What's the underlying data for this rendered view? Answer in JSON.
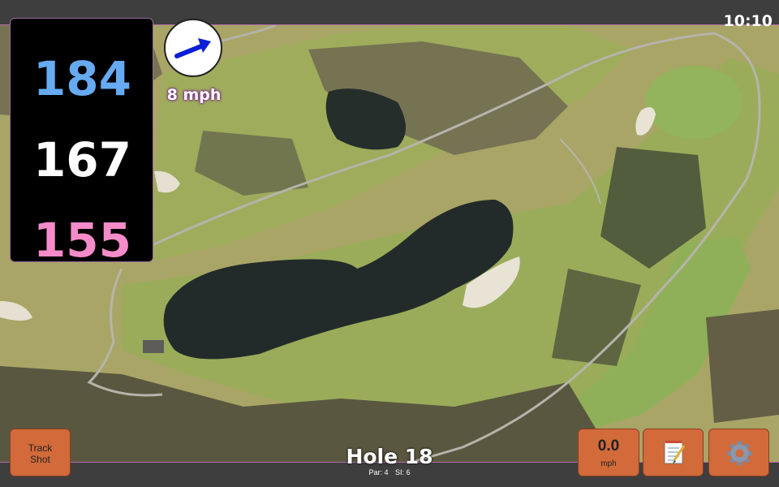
{
  "status": {
    "clock": "10:10"
  },
  "distances": {
    "back": "184",
    "middle": "167",
    "front": "155"
  },
  "wind": {
    "speed": "8 mph",
    "icon": "wind-direction-arrow-icon",
    "arrow_color": "#0a1fd6"
  },
  "hole": {
    "title": "Hole 18",
    "par": "Par: 4",
    "si": "SI: 6"
  },
  "buttons": {
    "track_shot": "Track\nShot",
    "speed_value": "0.0",
    "speed_unit": "mph",
    "notes_icon": "notepad-icon",
    "settings_icon": "gear-icon"
  },
  "colors": {
    "back": "#66aaf2",
    "middle": "#ffffff",
    "front": "#f58bc8",
    "button": "#d26a3a"
  }
}
